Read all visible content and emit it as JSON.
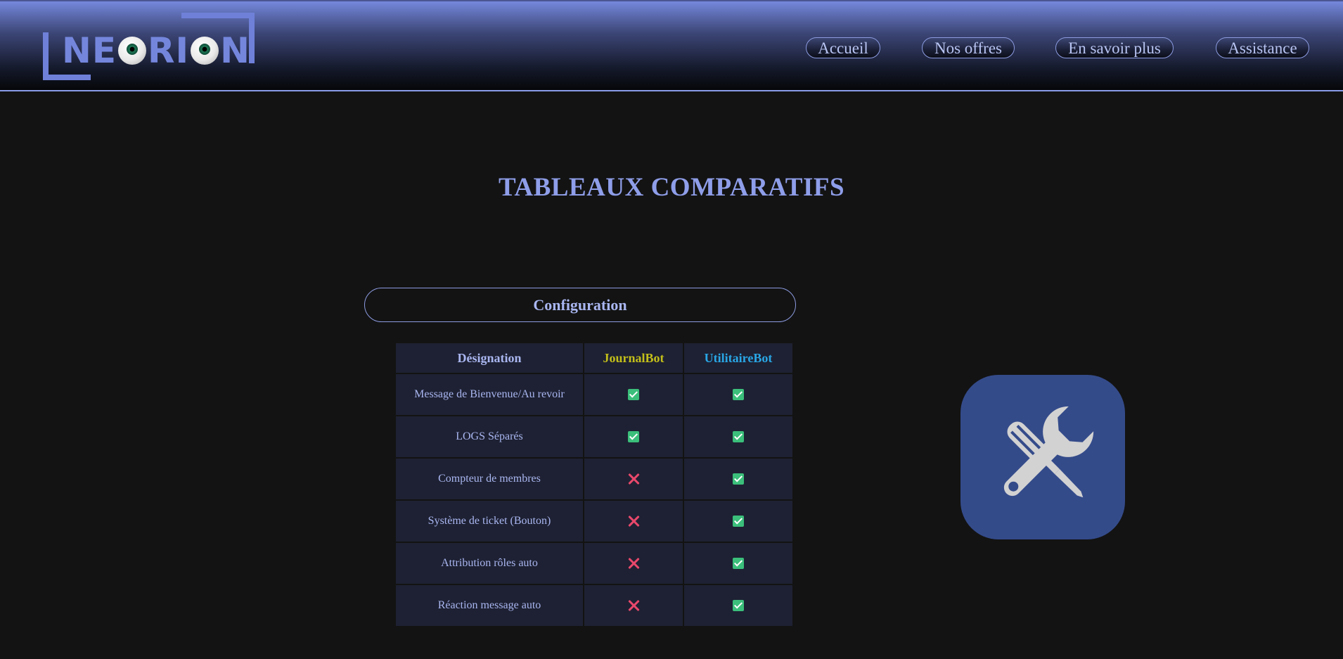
{
  "header": {
    "logo_text": "NEORION",
    "nav": [
      {
        "label": "Accueil"
      },
      {
        "label": "Nos offres"
      },
      {
        "label": "En savoir plus"
      },
      {
        "label": "Assistance"
      }
    ]
  },
  "main": {
    "title": "TABLEAUX COMPARATIFS",
    "section": "Configuration",
    "table": {
      "headers": [
        "Désignation",
        "JournalBot",
        "UtilitaireBot"
      ],
      "rows": [
        {
          "label": "Message de Bienvenue/Au revoir",
          "journalbot": "yes",
          "utilitairebot": "yes"
        },
        {
          "label": "LOGS Séparés",
          "journalbot": "yes",
          "utilitairebot": "yes"
        },
        {
          "label": "Compteur de membres",
          "journalbot": "no",
          "utilitairebot": "yes"
        },
        {
          "label": "Système de ticket (Bouton)",
          "journalbot": "no",
          "utilitairebot": "yes"
        },
        {
          "label": "Attribution rôles auto",
          "journalbot": "no",
          "utilitairebot": "yes"
        },
        {
          "label": "Réaction message auto",
          "journalbot": "no",
          "utilitairebot": "yes"
        }
      ]
    },
    "side_icon": "wrench-screwdriver-icon"
  },
  "colors": {
    "accent": "#8f9ee9",
    "journalbot": "#c3bf1a",
    "utilitairebot": "#29a6e6",
    "check": "#3bbf7b",
    "cross": "#e8486b",
    "icon_bg": "#344b8a"
  }
}
